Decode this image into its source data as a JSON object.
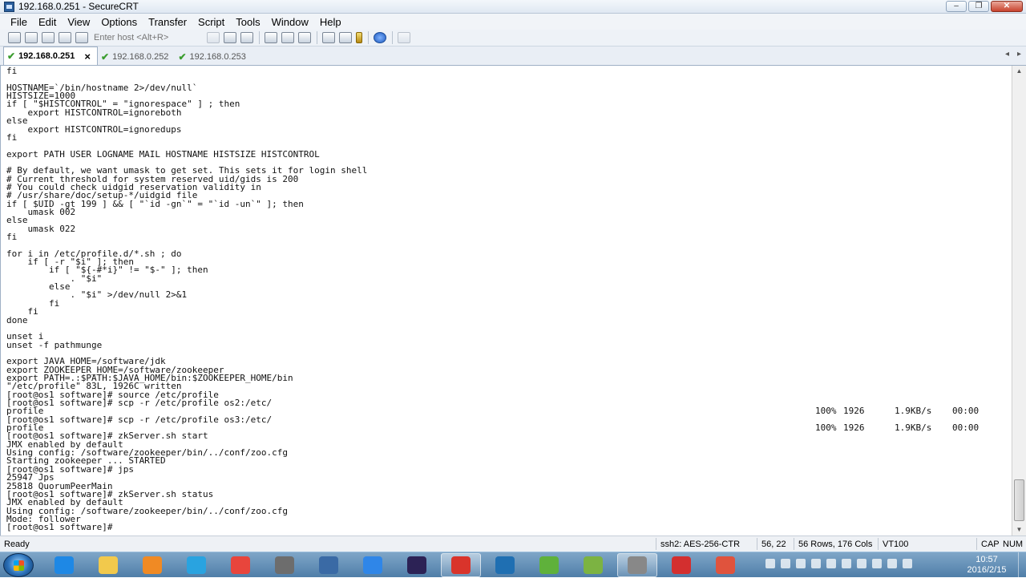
{
  "window": {
    "title": "192.168.0.251 - SecureCRT",
    "minimize": "–",
    "maximize": "❐",
    "close": "✕"
  },
  "menu": [
    "File",
    "Edit",
    "View",
    "Options",
    "Transfer",
    "Script",
    "Tools",
    "Window",
    "Help"
  ],
  "toolbar": {
    "host_placeholder": "Enter host <Alt+R>"
  },
  "tabs": [
    {
      "label": "192.168.0.251",
      "active": true,
      "status_icon": "check-icon"
    },
    {
      "label": "192.168.0.252",
      "active": false,
      "status_icon": "check-icon"
    },
    {
      "label": "192.168.0.253",
      "active": false,
      "status_icon": "check-icon"
    }
  ],
  "tab_nav": {
    "prev": "◂",
    "next": "▸"
  },
  "terminal": {
    "lines": [
      "fi",
      "",
      "HOSTNAME=`/bin/hostname 2>/dev/null`",
      "HISTSIZE=1000",
      "if [ \"$HISTCONTROL\" = \"ignorespace\" ] ; then",
      "    export HISTCONTROL=ignoreboth",
      "else",
      "    export HISTCONTROL=ignoredups",
      "fi",
      "",
      "export PATH USER LOGNAME MAIL HOSTNAME HISTSIZE HISTCONTROL",
      "",
      "# By default, we want umask to get set. This sets it for login shell",
      "# Current threshold for system reserved uid/gids is 200",
      "# You could check uidgid reservation validity in",
      "# /usr/share/doc/setup-*/uidgid file",
      "if [ $UID -gt 199 ] && [ \"`id -gn`\" = \"`id -un`\" ]; then",
      "    umask 002",
      "else",
      "    umask 022",
      "fi",
      "",
      "for i in /etc/profile.d/*.sh ; do",
      "    if [ -r \"$i\" ]; then",
      "        if [ \"${-#*i}\" != \"$-\" ]; then",
      "            . \"$i\"",
      "        else",
      "            . \"$i\" >/dev/null 2>&1",
      "        fi",
      "    fi",
      "done",
      "",
      "unset i",
      "unset -f pathmunge",
      "",
      "export JAVA_HOME=/software/jdk",
      "export ZOOKEEPER_HOME=/software/zookeeper",
      "export PATH=.:$PATH:$JAVA_HOME/bin:$ZOOKEEPER_HOME/bin",
      "\"/etc/profile\" 83L, 1926C written",
      "[root@os1 software]# source /etc/profile",
      "[root@os1 software]# scp -r /etc/profile os2:/etc/",
      "profile",
      "[root@os1 software]# scp -r /etc/profile os3:/etc/",
      "profile",
      "[root@os1 software]# zkServer.sh start",
      "JMX enabled by default",
      "Using config: /software/zookeeper/bin/../conf/zoo.cfg",
      "Starting zookeeper ... STARTED",
      "[root@os1 software]# jps",
      "25947 Jps",
      "25818 QuorumPeerMain",
      "[root@os1 software]# zkServer.sh status",
      "JMX enabled by default",
      "Using config: /software/zookeeper/bin/../conf/zoo.cfg",
      "Mode: follower",
      "[root@os1 software]# "
    ],
    "transfers": [
      {
        "line": 41,
        "percent": "100%",
        "size": "1926",
        "rate": "1.9KB/s",
        "time": "00:00"
      },
      {
        "line": 43,
        "percent": "100%",
        "size": "1926",
        "rate": "1.9KB/s",
        "time": "00:00"
      }
    ]
  },
  "statusbar": {
    "ready": "Ready",
    "cipher": "ssh2: AES-256-CTR",
    "cursor": "56,  22",
    "size": "56 Rows, 176 Cols",
    "emulation": "VT100",
    "caps": "CAP",
    "num": "NUM"
  },
  "taskbar": {
    "time": "10:57",
    "date": "2016/2/15",
    "apps": [
      {
        "name": "internet-explorer",
        "color": "#1e88e5"
      },
      {
        "name": "file-explorer",
        "color": "#f2c94c"
      },
      {
        "name": "media-player",
        "color": "#f08a24"
      },
      {
        "name": "network-app",
        "color": "#29a3e0"
      },
      {
        "name": "chrome",
        "color": "#e8453c"
      },
      {
        "name": "securecrt",
        "color": "#6d6d6d"
      },
      {
        "name": "remote-tool",
        "color": "#3a6aa5"
      },
      {
        "name": "feather-app",
        "color": "#2f86e8"
      },
      {
        "name": "eclipse",
        "color": "#2c2255"
      },
      {
        "name": "filezilla",
        "color": "#d9342b"
      },
      {
        "name": "virtualbox",
        "color": "#1f6fb2"
      },
      {
        "name": "pycharm",
        "color": "#5fb13b"
      },
      {
        "name": "mindmap-app",
        "color": "#7cb342"
      },
      {
        "name": "securecrt-active",
        "color": "#888888"
      },
      {
        "name": "xmind",
        "color": "#d32f2f"
      },
      {
        "name": "transfer-app",
        "color": "#e0533d"
      }
    ]
  }
}
